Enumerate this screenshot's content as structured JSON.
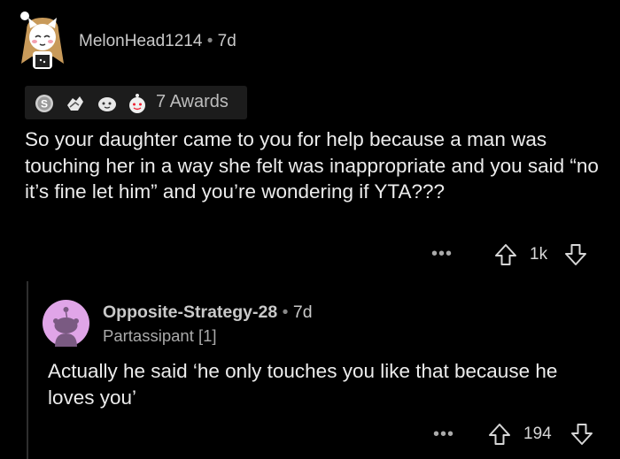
{
  "comment1": {
    "username": "MelonHead1214",
    "separator": "•",
    "time": "7d",
    "awards": {
      "icons": [
        "silver-award-icon",
        "helpful-award-icon",
        "wholesome-award-icon",
        "hugz-award-icon"
      ],
      "label": "7 Awards"
    },
    "body": "So your daughter came to you for help because a man was touching her in a way she felt was inappropriate and you said “no it’s fine let him” and you’re wondering if YTA???",
    "more": "•••",
    "score": "1k"
  },
  "comment2": {
    "username": "Opposite-Strategy-28",
    "separator": "•",
    "time": "7d",
    "flair": "Partassipant [1]",
    "body": "Actually he said ‘he only touches you like that because he loves you’",
    "more": "•••",
    "score": "194"
  },
  "colors": {
    "background": "#000000",
    "text": "#ececec",
    "muted": "#aaaaaa",
    "avatar2_bg": "#e0a5e8"
  }
}
